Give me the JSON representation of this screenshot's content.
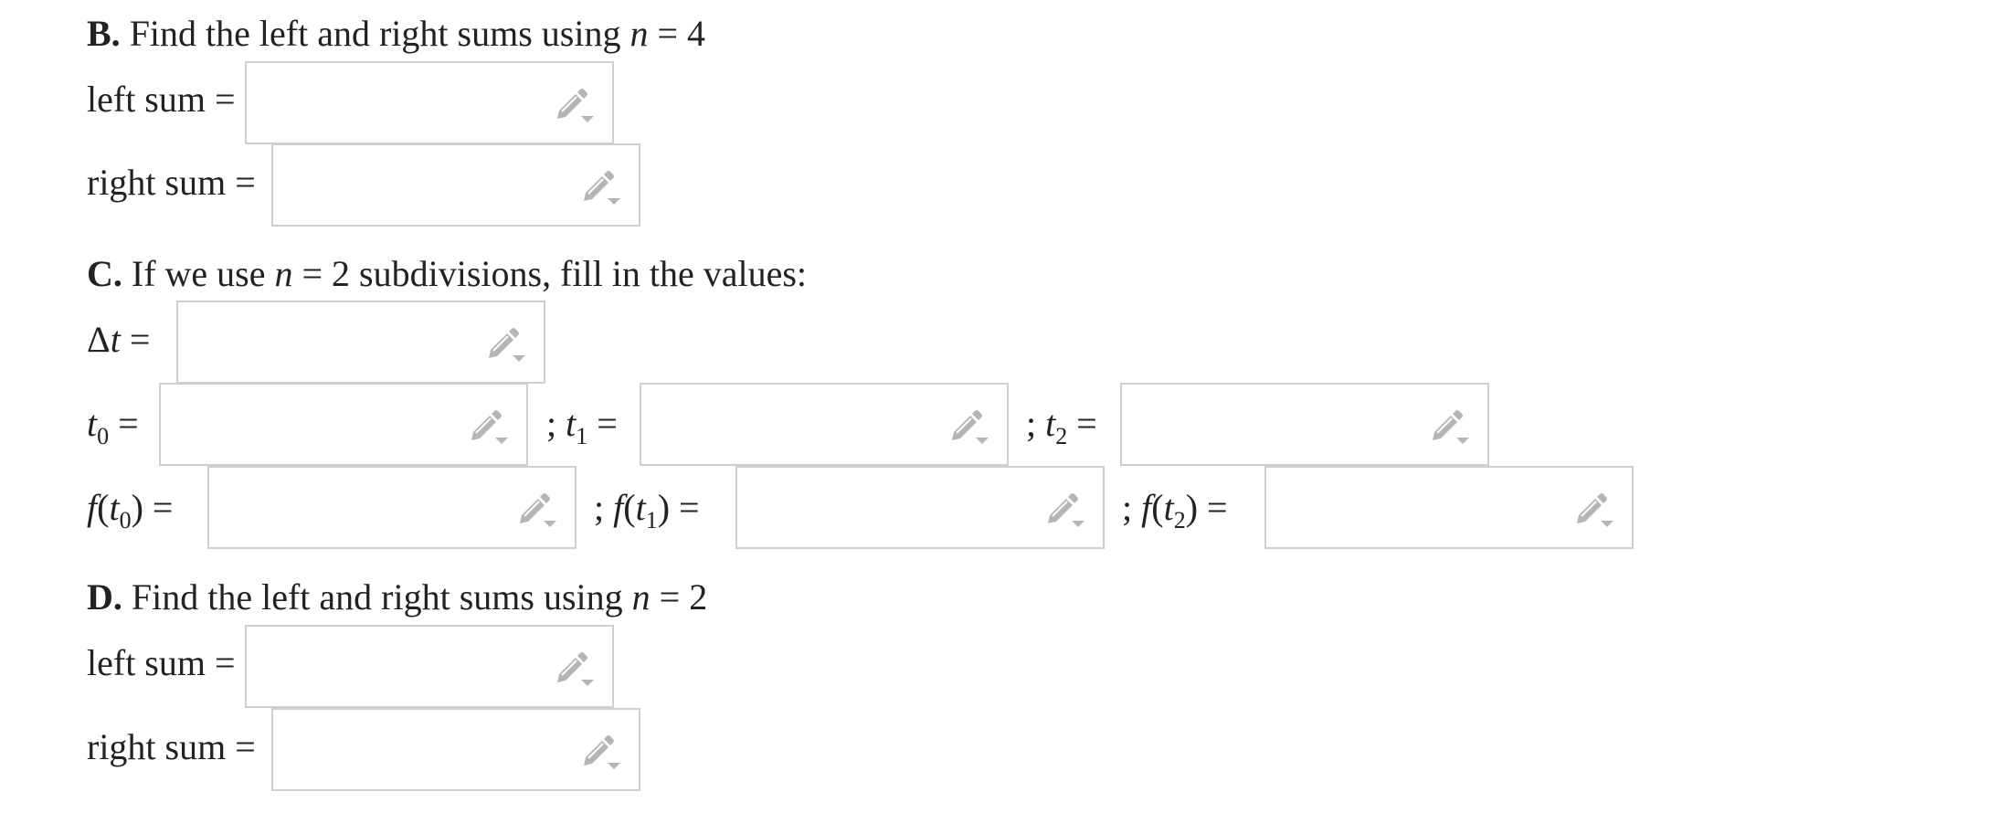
{
  "partB": {
    "letter": "B.",
    "text": "Find the left and right sums using",
    "var": "n",
    "eq": "= 4",
    "left_label": "left sum =",
    "right_label": "right sum ="
  },
  "partC": {
    "letter": "C.",
    "text_a": "If we use",
    "var": "n",
    "text_b": "= 2 subdivisions, fill in the values:",
    "dt_delta": "Δ",
    "dt_var": "t",
    "dt_eq": "=",
    "t0": {
      "var": "t",
      "sub": "0",
      "eq": "="
    },
    "t1": {
      "sep": ";",
      "var": "t",
      "sub": "1",
      "eq": "="
    },
    "t2": {
      "sep": ";",
      "var": "t",
      "sub": "2",
      "eq": "="
    },
    "f0": {
      "f": "f",
      "open": "(",
      "var": "t",
      "sub": "0",
      "close": ")",
      "eq": "="
    },
    "f1": {
      "sep": ";",
      "f": "f",
      "open": "(",
      "var": "t",
      "sub": "1",
      "close": ")",
      "eq": "="
    },
    "f2": {
      "sep": ";",
      "f": "f",
      "open": "(",
      "var": "t",
      "sub": "2",
      "close": ")",
      "eq": "="
    }
  },
  "partD": {
    "letter": "D.",
    "text": "Find the left and right sums using",
    "var": "n",
    "eq": "= 2",
    "left_label": "left sum =",
    "right_label": "right sum ="
  },
  "inputs": {
    "b_left": "",
    "b_right": "",
    "c_dt": "",
    "c_t0": "",
    "c_t1": "",
    "c_t2": "",
    "c_f0": "",
    "c_f1": "",
    "c_f2": "",
    "d_left": "",
    "d_right": ""
  },
  "icons": {
    "answer_box_icon": "pencil-dropdown-icon"
  },
  "colors": {
    "text": "#222222",
    "box_border": "#cfcfcf",
    "icon": "#b5b5b5"
  }
}
